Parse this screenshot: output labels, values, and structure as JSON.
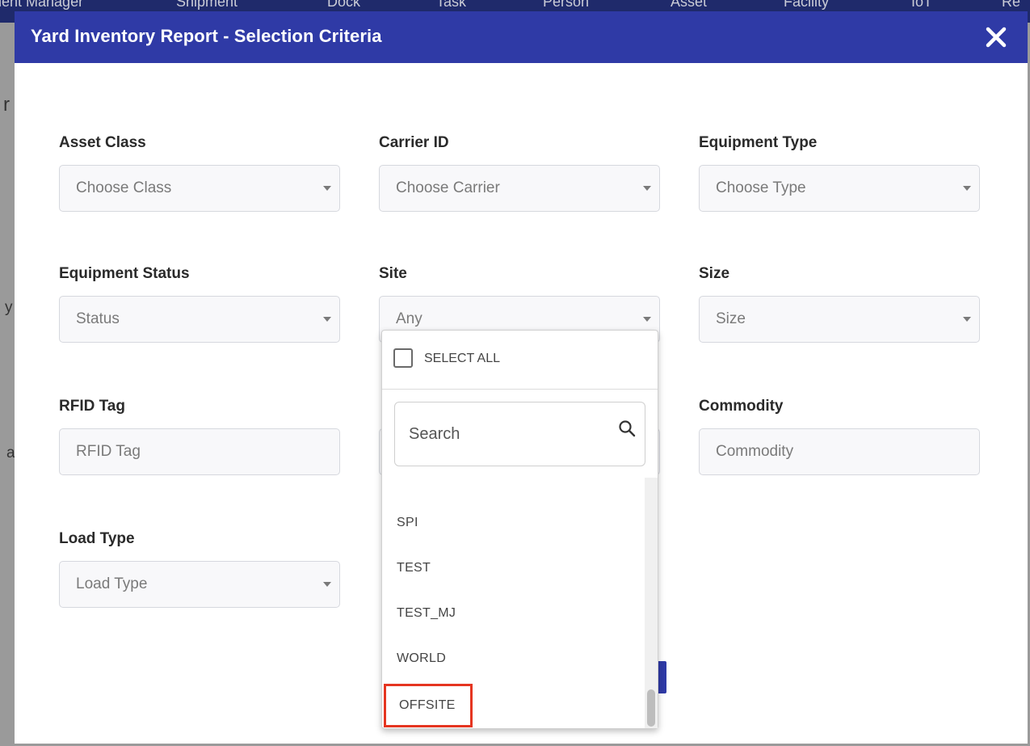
{
  "background": {
    "nav_items": [
      "nent Manager",
      "Shipment",
      "Dock",
      "Task",
      "Person",
      "Asset",
      "Facility",
      "IoT",
      "Re"
    ],
    "page_fragments": [
      "r",
      "y",
      "a"
    ]
  },
  "modal": {
    "title": "Yard Inventory Report - Selection Criteria",
    "close_icon": "close-icon",
    "fields": {
      "asset_class": {
        "label": "Asset Class",
        "placeholder": "Choose Class"
      },
      "carrier_id": {
        "label": "Carrier ID",
        "placeholder": "Choose Carrier"
      },
      "equipment_type": {
        "label": "Equipment Type",
        "placeholder": "Choose Type"
      },
      "equipment_status": {
        "label": "Equipment Status",
        "placeholder": "Status"
      },
      "site": {
        "label": "Site",
        "value": "Any"
      },
      "size": {
        "label": "Size",
        "placeholder": "Size"
      },
      "rfid_tag": {
        "label": "RFID Tag",
        "placeholder": "RFID Tag"
      },
      "commodity": {
        "label": "Commodity",
        "placeholder": "Commodity"
      },
      "load_type": {
        "label": "Load Type",
        "placeholder": "Load Type"
      }
    },
    "site_dropdown": {
      "select_all_label": "SELECT ALL",
      "search_placeholder": "Search",
      "options": [
        "SPI",
        "TEST",
        "TEST_MJ",
        "WORLD",
        "OFFSITE"
      ],
      "highlighted_option": "OFFSITE"
    }
  },
  "colors": {
    "header": "#2f3aa6",
    "highlight_border": "#e53520"
  }
}
